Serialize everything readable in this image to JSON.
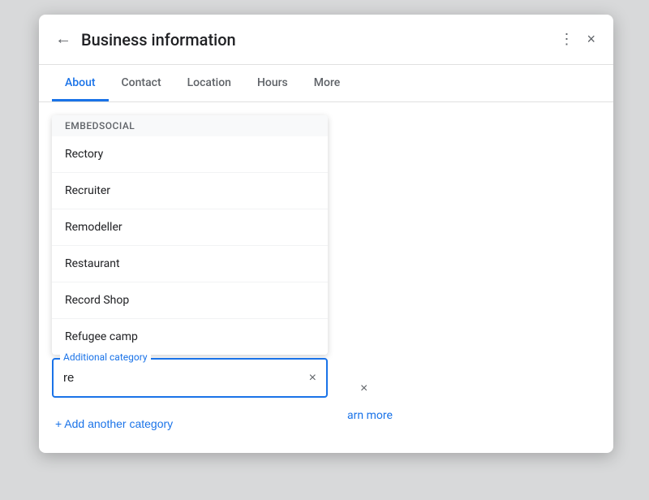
{
  "dialog": {
    "title": "Business information",
    "back_label": "←",
    "more_icon": "⋮",
    "close_icon": "×"
  },
  "tabs": [
    {
      "label": "About",
      "active": true
    },
    {
      "label": "Contact",
      "active": false
    },
    {
      "label": "Location",
      "active": false
    },
    {
      "label": "Hours",
      "active": false
    },
    {
      "label": "More",
      "active": false
    }
  ],
  "suggestions_header": "EmbedSocial",
  "suggestions": [
    {
      "label": "Rectory"
    },
    {
      "label": "Recruiter"
    },
    {
      "label": "Remodeller"
    },
    {
      "label": "Restaurant"
    },
    {
      "label": "Record Shop"
    },
    {
      "label": "Refugee camp"
    }
  ],
  "additional_category_label": "Additional category",
  "input_value": "re",
  "learn_more_text": "arn more",
  "add_category_label": "+  Add another category",
  "primary_clear_icon": "×",
  "secondary_clear_icon": "×"
}
